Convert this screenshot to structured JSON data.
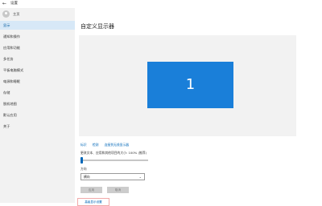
{
  "window": {
    "title": "设置"
  },
  "sidebar": {
    "home_label": "主页",
    "items": [
      {
        "label": "显示",
        "active": true
      },
      {
        "label": "通知和操作",
        "active": false
      },
      {
        "label": "应用和功能",
        "active": false
      },
      {
        "label": "多任务",
        "active": false
      },
      {
        "label": "平板电脑模式",
        "active": false
      },
      {
        "label": "电源和睡眠",
        "active": false
      },
      {
        "label": "存储",
        "active": false
      },
      {
        "label": "脱机地图",
        "active": false
      },
      {
        "label": "默认应用",
        "active": false
      },
      {
        "label": "关于",
        "active": false
      }
    ]
  },
  "main": {
    "title": "自定义显示器",
    "preview": {
      "monitor_number": "1",
      "monitor_color": "#1a7fd9"
    },
    "links": [
      "标识",
      "检测",
      "连接到无线显示器"
    ],
    "scale_label": "更改文本、应用和其他项目的大小: 100% (推荐)",
    "scale_percent": 100,
    "orientation_label": "方向",
    "orientation_value": "横向",
    "apply_label": "应用",
    "cancel_label": "取消",
    "advanced_link": "高级显示设置"
  },
  "colors": {
    "accent": "#0067b8",
    "sidebar_active": "#d7e8f7"
  }
}
